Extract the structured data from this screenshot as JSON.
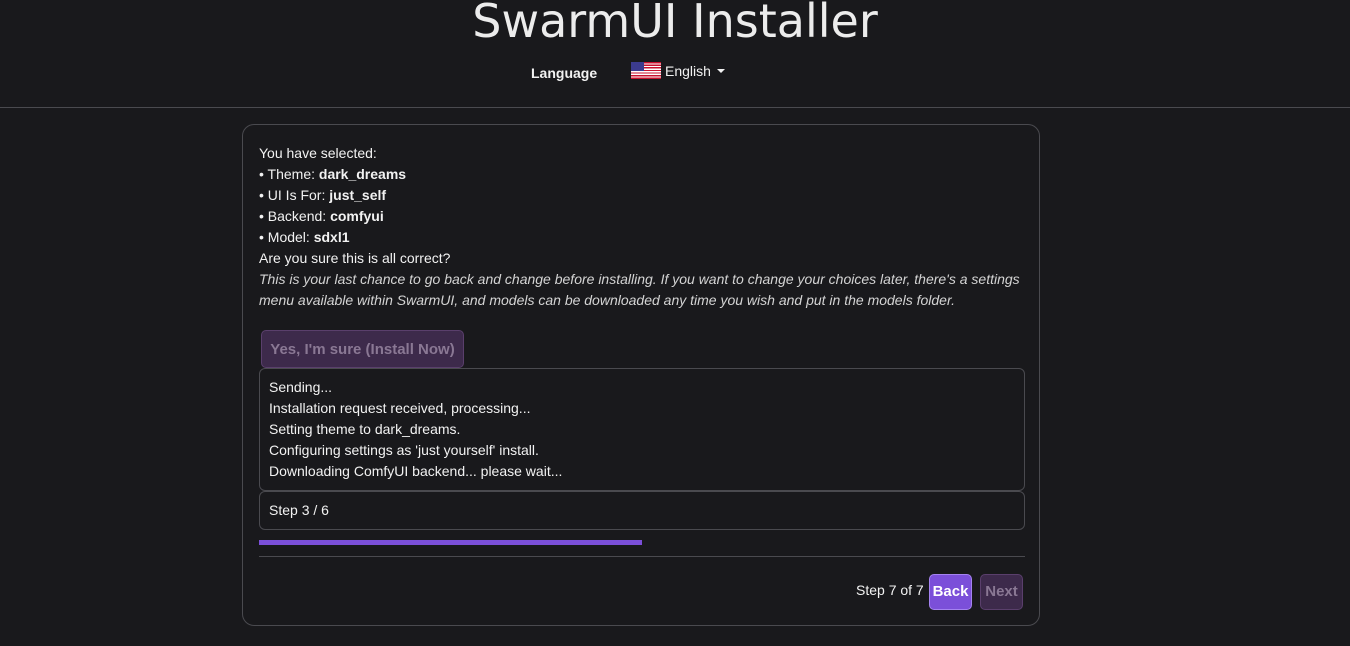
{
  "header": {
    "title": "SwarmUI Installer",
    "language_label": "Language",
    "language_selected": "English",
    "language_flag_icon": "us-flag-icon"
  },
  "summary": {
    "intro": "You have selected:",
    "items": [
      {
        "label": "• Theme: ",
        "value": "dark_dreams"
      },
      {
        "label": "• UI Is For: ",
        "value": "just_self"
      },
      {
        "label": "• Backend: ",
        "value": "comfyui"
      },
      {
        "label": "• Model: ",
        "value": "sdxl1"
      }
    ],
    "question": "Are you sure this is all correct?",
    "note": "This is your last chance to go back and change before installing. If you want to change your choices later, there's a settings menu available within SwarmUI, and models can be downloaded any time you wish and put in the models folder."
  },
  "install_button": "Yes, I'm sure (Install Now)",
  "log": [
    "Sending...",
    "Installation request received, processing...",
    "Setting theme to dark_dreams.",
    "Configuring settings as 'just yourself' install.",
    "Downloading ComfyUI backend... please wait..."
  ],
  "install_step": "Step 3 / 6",
  "progress": {
    "fraction": 0.5,
    "color": "#7b4fd9"
  },
  "footer": {
    "step_text": "Step 7 of 7",
    "back_label": "Back",
    "next_label": "Next"
  },
  "colors": {
    "background": "#19191c",
    "accent": "#7b4fd9",
    "disabled_button": "#3d2a4b"
  }
}
